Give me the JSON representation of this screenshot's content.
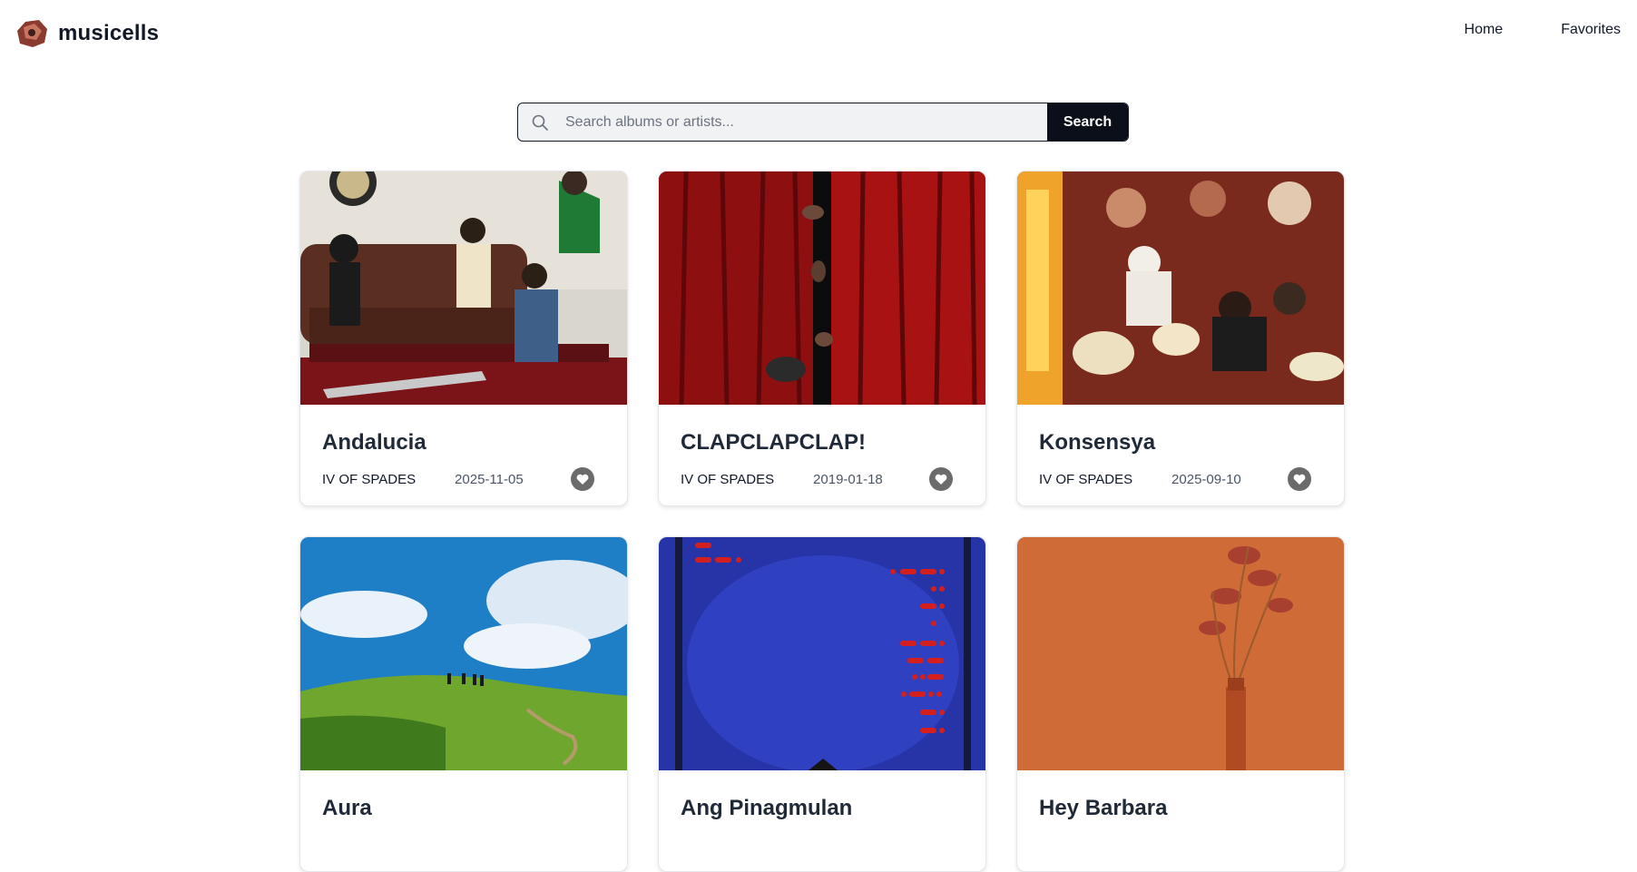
{
  "app": {
    "name": "musicells"
  },
  "nav": {
    "items": [
      {
        "label": "Home"
      },
      {
        "label": "Favorites"
      }
    ]
  },
  "search": {
    "placeholder": "Search albums or artists...",
    "value": "",
    "button_label": "Search"
  },
  "albums": [
    {
      "title": "Andalucia",
      "artist": "IV OF SPADES",
      "date": "2025-11-05",
      "cover": "band-on-couch"
    },
    {
      "title": "CLAPCLAPCLAP!",
      "artist": "IV OF SPADES",
      "date": "2019-01-18",
      "cover": "red-curtains"
    },
    {
      "title": "Konsensya",
      "artist": "IV OF SPADES",
      "date": "2025-09-10",
      "cover": "crowded-party"
    },
    {
      "title": "Aura",
      "artist": "",
      "date": "",
      "cover": "green-hill-sky"
    },
    {
      "title": "Ang Pinagmulan",
      "artist": "",
      "date": "",
      "cover": "blue-morse-code"
    },
    {
      "title": "Hey Barbara",
      "artist": "",
      "date": "",
      "cover": "orange-flower-vase"
    }
  ],
  "icons": {
    "search": "search-icon",
    "favorite": "heart-icon",
    "logo": "album-logo-icon"
  },
  "colors": {
    "accent": "#0b0f1a",
    "favorite": "#6b6b6b"
  }
}
